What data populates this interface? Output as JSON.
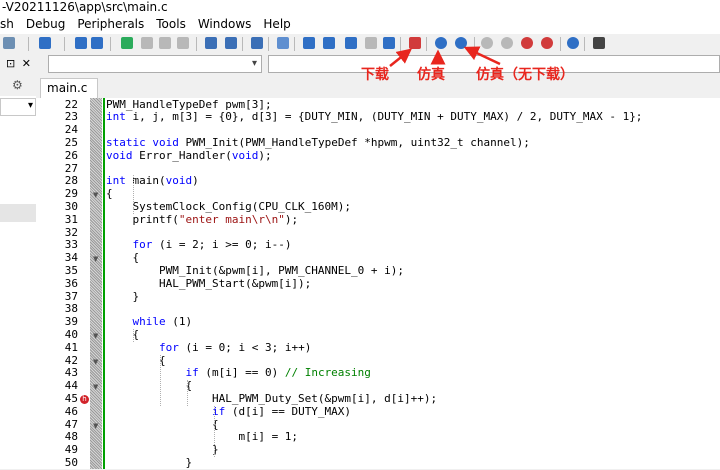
{
  "window": {
    "title": "-V20211126\\app\\src\\main.c"
  },
  "menu": {
    "items": [
      "sh",
      "Debug",
      "Peripherals",
      "Tools",
      "Windows",
      "Help"
    ]
  },
  "toolbar": {
    "buttons": [
      {
        "name": "undo-icon",
        "color": "#6d8fb3"
      },
      {
        "name": "redo-icon",
        "color": "#2f6fc5"
      },
      {
        "name": "nav-back-icon",
        "color": "#2f6fc5"
      },
      {
        "name": "nav-forward-icon",
        "color": "#2f6fc5"
      },
      {
        "name": "bookmark-icon",
        "color": "#2bab5b"
      },
      {
        "name": "bookmark-prev-icon",
        "color": "#b8b8b8"
      },
      {
        "name": "bookmark-next-icon",
        "color": "#b8b8b8"
      },
      {
        "name": "bookmark-clear-icon",
        "color": "#b8b8b8"
      },
      {
        "name": "find-icon",
        "color": "#3b6fb6"
      },
      {
        "name": "replace-icon",
        "color": "#3b6fb6"
      },
      {
        "name": "find-in-files-icon",
        "color": "#3b6fb6"
      },
      {
        "name": "configure-icon",
        "color": "#5f8fd0"
      },
      {
        "name": "build-icon",
        "color": "#2f6fc5"
      },
      {
        "name": "rebuild-icon",
        "color": "#2f6fc5"
      },
      {
        "name": "batch-build-icon",
        "color": "#2f6fc5"
      },
      {
        "name": "stop-build-icon",
        "color": "#b8b8b8"
      },
      {
        "name": "download-icon",
        "color": "#2f6fc5"
      },
      {
        "name": "flash-erase-icon",
        "color": "#d13b3b"
      },
      {
        "name": "debug-icon",
        "color": "#2f6fc5"
      },
      {
        "name": "debug-no-download-icon",
        "color": "#2f6fc5"
      },
      {
        "name": "run-icon",
        "color": "#b8b8b8"
      },
      {
        "name": "step-icon",
        "color": "#b8b8b8"
      },
      {
        "name": "insert-breakpoint-icon",
        "color": "#d13b3b"
      },
      {
        "name": "kill-breakpoints-icon",
        "color": "#d13b3b"
      },
      {
        "name": "headset-icon",
        "color": "#2f6fc5"
      },
      {
        "name": "settings-bug-icon",
        "color": "#444444"
      }
    ]
  },
  "tabs": [
    {
      "label": "main.c",
      "close": "×"
    }
  ],
  "left_panel": {
    "pin": "⊡",
    "close": "✕",
    "icon": "⚙",
    "combo_arrow": "▾"
  },
  "editor": {
    "lines": [
      {
        "n": 22,
        "code": [
          [
            "t",
            "PWM_HandleTypeDef pwm[3];"
          ]
        ]
      },
      {
        "n": 23,
        "code": [
          [
            "k",
            "int"
          ],
          [
            "t",
            " i, j, m[3] = {0}, d[3] = {DUTY_MIN, (DUTY_MIN + DUTY_MAX) / 2, DUTY_MAX - 1};"
          ]
        ]
      },
      {
        "n": 24,
        "code": []
      },
      {
        "n": 25,
        "code": [
          [
            "k",
            "static"
          ],
          [
            "t",
            " "
          ],
          [
            "k",
            "void"
          ],
          [
            "t",
            " PWM_Init(PWM_HandleTypeDef *hpwm, uint32_t channel);"
          ]
        ]
      },
      {
        "n": 26,
        "code": [
          [
            "k",
            "void"
          ],
          [
            "t",
            " Error_Handler("
          ],
          [
            "k",
            "void"
          ],
          [
            "t",
            ");"
          ]
        ]
      },
      {
        "n": 27,
        "code": []
      },
      {
        "n": 28,
        "code": [
          [
            "k",
            "int"
          ],
          [
            "t",
            " main("
          ],
          [
            "k",
            "void"
          ],
          [
            "t",
            ")"
          ]
        ]
      },
      {
        "n": 29,
        "code": [
          [
            "t",
            "{"
          ]
        ]
      },
      {
        "n": 30,
        "code": [
          [
            "t",
            "    SystemClock_Config(CPU_CLK_160M);"
          ]
        ]
      },
      {
        "n": 31,
        "code": [
          [
            "t",
            "    printf("
          ],
          [
            "s",
            "\"enter main\\r\\n\""
          ],
          [
            "t",
            ");"
          ]
        ]
      },
      {
        "n": 32,
        "code": []
      },
      {
        "n": 33,
        "code": [
          [
            "t",
            "    "
          ],
          [
            "k",
            "for"
          ],
          [
            "t",
            " (i = 2; i >= 0; i--)"
          ]
        ]
      },
      {
        "n": 34,
        "code": [
          [
            "t",
            "    {"
          ]
        ]
      },
      {
        "n": 35,
        "code": [
          [
            "t",
            "        PWM_Init(&pwm[i], PWM_CHANNEL_0 + i);"
          ]
        ]
      },
      {
        "n": 36,
        "code": [
          [
            "t",
            "        HAL_PWM_Start(&pwm[i]);"
          ]
        ]
      },
      {
        "n": 37,
        "code": [
          [
            "t",
            "    }"
          ]
        ]
      },
      {
        "n": 38,
        "code": []
      },
      {
        "n": 39,
        "code": [
          [
            "t",
            "    "
          ],
          [
            "k",
            "while"
          ],
          [
            "t",
            " (1)"
          ]
        ]
      },
      {
        "n": 40,
        "code": [
          [
            "t",
            "    {"
          ]
        ]
      },
      {
        "n": 41,
        "code": [
          [
            "t",
            "        "
          ],
          [
            "k",
            "for"
          ],
          [
            "t",
            " (i = 0; i < 3; i++)"
          ]
        ]
      },
      {
        "n": 42,
        "code": [
          [
            "t",
            "        {"
          ]
        ]
      },
      {
        "n": 43,
        "code": [
          [
            "t",
            "            "
          ],
          [
            "k",
            "if"
          ],
          [
            "t",
            " (m[i] == 0) "
          ],
          [
            "c",
            "// Increasing"
          ]
        ]
      },
      {
        "n": 44,
        "code": [
          [
            "t",
            "            {"
          ]
        ]
      },
      {
        "n": 45,
        "code": [
          [
            "t",
            "                HAL_PWM_Duty_Set(&pwm[i], d[i]++);"
          ]
        ]
      },
      {
        "n": 46,
        "code": [
          [
            "t",
            "                "
          ],
          [
            "k",
            "if"
          ],
          [
            "t",
            " (d[i] == DUTY_MAX)"
          ]
        ]
      },
      {
        "n": 47,
        "code": [
          [
            "t",
            "                {"
          ]
        ]
      },
      {
        "n": 48,
        "code": [
          [
            "t",
            "                    m[i] = 1;"
          ]
        ]
      },
      {
        "n": 49,
        "code": [
          [
            "t",
            "                }"
          ]
        ]
      },
      {
        "n": 50,
        "code": [
          [
            "t",
            "            }"
          ]
        ]
      }
    ],
    "breakpoint_marker": "h"
  },
  "annotations": {
    "download": "下载",
    "debug": "仿真",
    "debug_no_download": "仿真（无下载）"
  },
  "colors": {
    "keyword": "#0000ff",
    "string": "#9b1111",
    "comment": "#008000",
    "annotation": "#e8261e",
    "modified_bar": "#00a000"
  }
}
